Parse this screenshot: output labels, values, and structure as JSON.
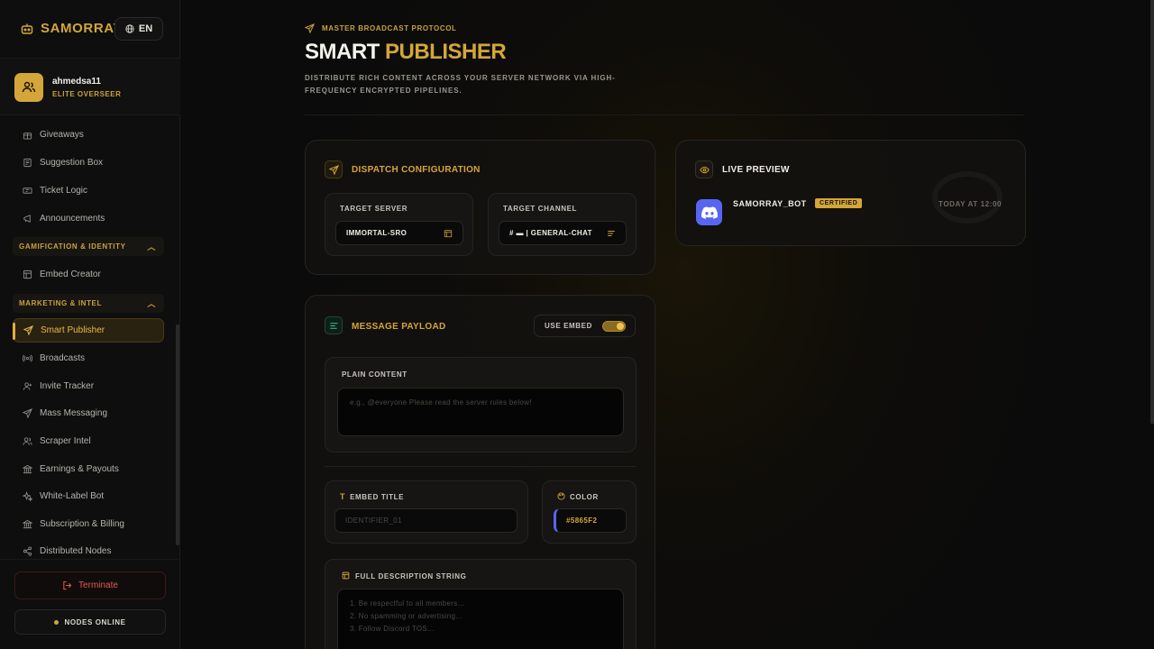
{
  "brand": {
    "name": "SAMORRAY",
    "lang": "EN"
  },
  "user": {
    "name": "ahmedsa11",
    "role": "ELITE OVERSEER"
  },
  "nav": {
    "items_top": [
      {
        "label": "Giveaways",
        "icon": "gift-icon"
      },
      {
        "label": "Suggestion Box",
        "icon": "suggestion-icon"
      },
      {
        "label": "Ticket Logic",
        "icon": "ticket-icon"
      },
      {
        "label": "Announcements",
        "icon": "megaphone-icon"
      }
    ],
    "group_gamification": "GAMIFICATION & IDENTITY",
    "embed_creator": "Embed Creator",
    "group_marketing": "MARKETING & INTEL",
    "items_marketing": [
      {
        "label": "Smart Publisher",
        "icon": "send-icon",
        "active": true
      },
      {
        "label": "Broadcasts",
        "icon": "broadcast-icon"
      },
      {
        "label": "Invite Tracker",
        "icon": "user-plus-icon"
      },
      {
        "label": "Mass Messaging",
        "icon": "send-icon"
      },
      {
        "label": "Scraper Intel",
        "icon": "users-icon"
      },
      {
        "label": "Earnings & Payouts",
        "icon": "bank-icon"
      },
      {
        "label": "White-Label Bot",
        "icon": "sparkle-icon"
      },
      {
        "label": "Subscription & Billing",
        "icon": "bank-icon"
      },
      {
        "label": "Distributed Nodes",
        "icon": "share-icon"
      }
    ]
  },
  "footer": {
    "terminate": "Terminate",
    "nodes": "NODES ONLINE"
  },
  "header": {
    "eyebrow": "MASTER BROADCAST PROTOCOL",
    "title_main": "SMART",
    "title_accent": "PUBLISHER",
    "subtitle": "DISTRIBUTE RICH CONTENT ACROSS YOUR SERVER NETWORK VIA HIGH-FREQUENCY ENCRYPTED PIPELINES."
  },
  "dispatch": {
    "title": "DISPATCH CONFIGURATION",
    "server_label": "TARGET SERVER",
    "server_value": "IMMORTAL-SRO",
    "channel_label": "TARGET CHANNEL",
    "channel_value": "# ▬ | GENERAL-CHAT"
  },
  "payload": {
    "title": "MESSAGE PAYLOAD",
    "use_embed_label": "USE EMBED",
    "use_embed": true,
    "plain_label": "PLAIN CONTENT",
    "plain_placeholder": "e.g., @everyone Please read the server rules below!",
    "embed_title_label": "EMBED TITLE",
    "embed_title_placeholder": "IDENTIFIER_01",
    "color_label": "COLOR",
    "color_value": "#5865F2",
    "description_label": "FULL DESCRIPTION STRING",
    "description_placeholder_lines": [
      "1. Be respectful to all members...",
      "2. No spamming or advertising...",
      "3. Follow Discord TOS..."
    ]
  },
  "preview": {
    "title": "LIVE PREVIEW",
    "bot_name": "SAMORRAY_BOT",
    "badge": "CERTIFIED",
    "timestamp": "TODAY AT 12:00"
  },
  "colors": {
    "accent": "#d4a63a",
    "discord": "#5865F2",
    "danger": "#e3584e"
  }
}
